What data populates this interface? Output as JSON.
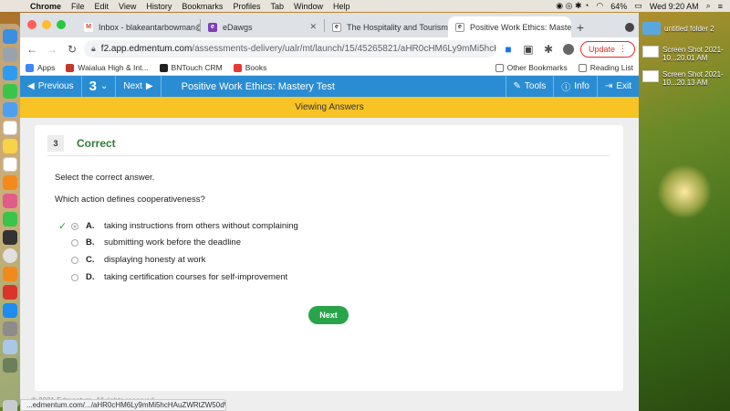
{
  "menubar": {
    "app": "Chrome",
    "items": [
      "File",
      "Edit",
      "View",
      "History",
      "Bookmarks",
      "Profiles",
      "Tab",
      "Window",
      "Help"
    ],
    "battery": "64%",
    "clock": "Wed 9:20 AM"
  },
  "desktop": {
    "items": [
      {
        "label": "untitled folder 2"
      },
      {
        "label": "Screen Shot 2021-10...20.01 AM"
      },
      {
        "label": "Screen Shot 2021-10...20.13 AM"
      }
    ]
  },
  "tabs": [
    {
      "title": "Inbox - blakeantarbowman@w",
      "icon": "gmail-icon",
      "color": "#ea4335",
      "glyph": "M"
    },
    {
      "title": "eDawgs",
      "icon": "edawgs-icon",
      "color": "#7b3fb5",
      "glyph": "e"
    },
    {
      "title": "The Hospitality and Tourism In",
      "icon": "edmentum-icon",
      "color": "#333333",
      "glyph": "e"
    },
    {
      "title": "Positive Work Ethics: Mastery",
      "icon": "edmentum-icon",
      "color": "#333333",
      "glyph": "e"
    }
  ],
  "toolbar": {
    "url_host": "f2.app.edmentum.com",
    "url_rest": "/assessments-delivery/ualr/mt/launch/15/45265821/aHR0cHM6Ly9mMi5hcHAuZWRtZW...",
    "update_label": "Update"
  },
  "bookmarks": {
    "items": [
      {
        "label": "Apps",
        "color": "#4285f4"
      },
      {
        "label": "Waialua High & Int...",
        "color": "#c0392b"
      },
      {
        "label": "BNTouch CRM",
        "color": "#222222"
      },
      {
        "label": "Books",
        "color": "#e53935"
      }
    ],
    "other": "Other Bookmarks",
    "reading": "Reading List"
  },
  "appbar": {
    "previous": "Previous",
    "question_number": "3",
    "next": "Next",
    "title": "Positive Work Ethics: Mastery Test",
    "tools": "Tools",
    "info": "Info",
    "exit": "Exit"
  },
  "banner": "Viewing Answers",
  "question": {
    "number": "3",
    "status": "Correct",
    "instruction": "Select the correct answer.",
    "prompt": "Which action defines cooperativeness?",
    "options": [
      {
        "letter": "A.",
        "text": "taking instructions from others without complaining",
        "selected": true,
        "correct": true
      },
      {
        "letter": "B.",
        "text": "submitting work before the deadline",
        "selected": false,
        "correct": false
      },
      {
        "letter": "C.",
        "text": "displaying honesty at work",
        "selected": false,
        "correct": false
      },
      {
        "letter": "D.",
        "text": "taking certification courses for self-improvement",
        "selected": false,
        "correct": false
      }
    ],
    "next_button": "Next"
  },
  "footer": "© 2021 Edmentum. All rights reserved.",
  "status_url": "...edmentum.com/.../aHR0cHM6Ly9mMi5hcHAuZWRtZW50dW..."
}
